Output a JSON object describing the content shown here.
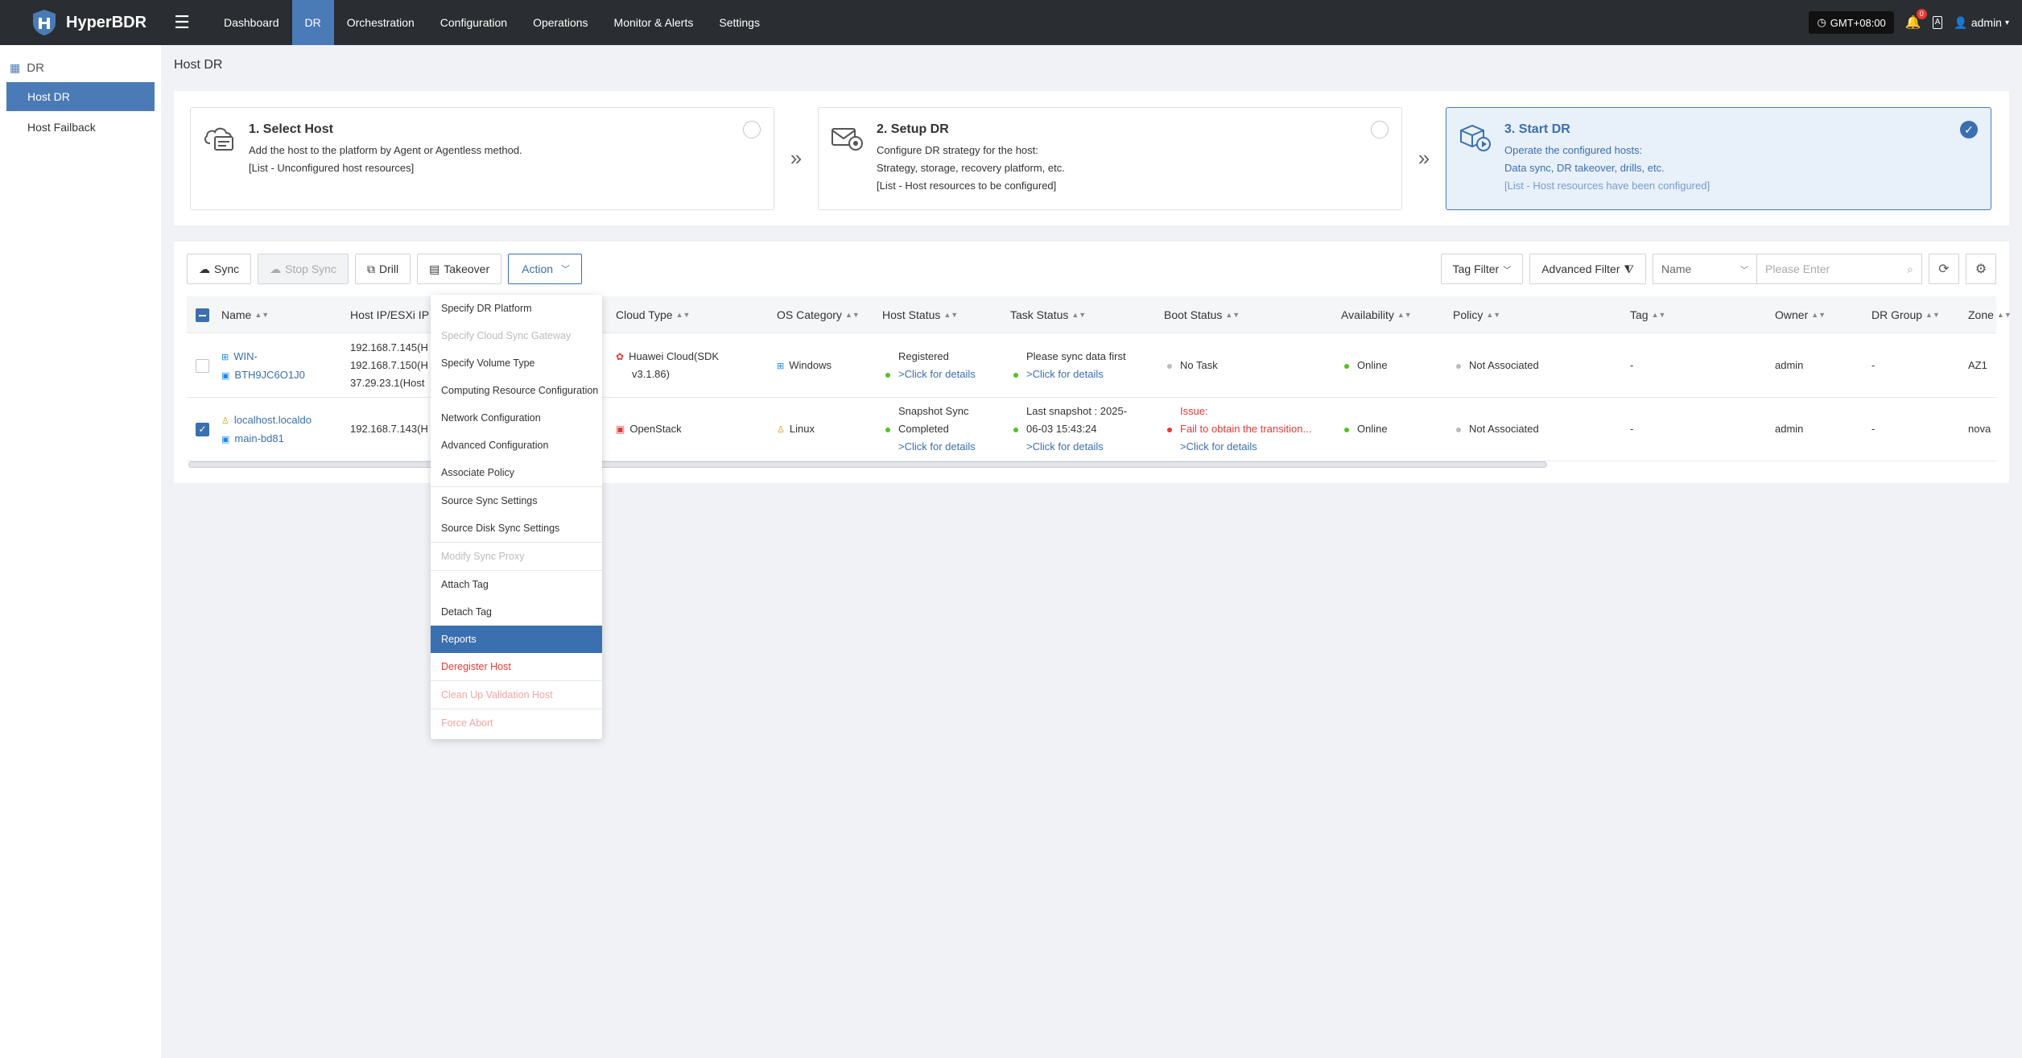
{
  "app": {
    "name": "HyperBDR",
    "nav": [
      "Dashboard",
      "DR",
      "Orchestration",
      "Configuration",
      "Operations",
      "Monitor & Alerts",
      "Settings"
    ],
    "timezone": "GMT+08:00",
    "notification_count": "0",
    "lang_icon_text": "A",
    "user": "admin"
  },
  "sidebar": {
    "title": "DR",
    "items": [
      "Host DR",
      "Host Failback"
    ]
  },
  "page": {
    "title": "Host DR"
  },
  "steps": [
    {
      "title": "1. Select Host",
      "line1": "Add the host to the platform by Agent or Agentless method.",
      "line2": "[List - Unconfigured host resources]"
    },
    {
      "title": "2. Setup DR",
      "line1": "Configure DR strategy for the host:",
      "line2": "Strategy, storage, recovery platform, etc.",
      "line3": "[List - Host resources to be configured]"
    },
    {
      "title": "3. Start DR",
      "line1": "Operate the configured hosts:",
      "line2": "Data sync, DR takeover, drills, etc.",
      "line3": "[List - Host resources have been configured]"
    }
  ],
  "toolbar": {
    "sync": "Sync",
    "stop_sync": "Stop Sync",
    "drill": "Drill",
    "takeover": "Takeover",
    "action": "Action",
    "tag_filter": "Tag Filter",
    "advanced_filter": "Advanced Filter",
    "search_field": "Name",
    "search_placeholder": "Please Enter"
  },
  "columns": [
    "Name",
    "Host IP/ESXi IP",
    "Cloud Type",
    "OS Category",
    "Host Status",
    "Task Status",
    "Boot Status",
    "Availability",
    "Policy",
    "Tag",
    "Owner",
    "DR Group",
    "Zone"
  ],
  "rows": [
    {
      "name1": "WIN-",
      "name2": "BTH9JC6O1J0",
      "ip1": "192.168.7.145(H",
      "ip2": "192.168.7.150(H",
      "ip3": "37.29.23.1(Host",
      "cloud1": "Huawei Cloud(SDK",
      "cloud2": "v3.1.86)",
      "os": "Windows",
      "host_status": "Registered",
      "host_link": ">Click for details",
      "task1": "Please sync data first",
      "task_link": ">Click for details",
      "boot": "No Task",
      "availability": "Online",
      "policy": "Not Associated",
      "tag": "-",
      "owner": "admin",
      "group": "-",
      "zone": "AZ1"
    },
    {
      "name1": "localhost.localdo",
      "name2": "main-bd81",
      "ip1": "192.168.7.143(H",
      "cloud1": "OpenStack",
      "os": "Linux",
      "host_status1": "Snapshot Sync",
      "host_status2": "Completed",
      "host_link": ">Click for details",
      "task1": "Last snapshot : 2025-",
      "task2": "06-03 15:43:24",
      "task_link": ">Click for details",
      "boot1": "Issue:",
      "boot2": "Fail to obtain the transition...",
      "boot_link": ">Click for details",
      "availability": "Online",
      "policy": "Not Associated",
      "tag": "-",
      "owner": "admin",
      "group": "-",
      "zone": "nova"
    }
  ],
  "action_menu": [
    "Specify DR Platform",
    "Specify Cloud Sync Gateway",
    "Specify Volume Type",
    "Computing Resource Configuration",
    "Network Configuration",
    "Advanced Configuration",
    "Associate Policy",
    "Source Sync Settings",
    "Source Disk Sync Settings",
    "Modify Sync Proxy",
    "Attach Tag",
    "Detach Tag",
    "Reports",
    "Deregister Host",
    "Clean Up Validation Host",
    "Force Abort"
  ]
}
